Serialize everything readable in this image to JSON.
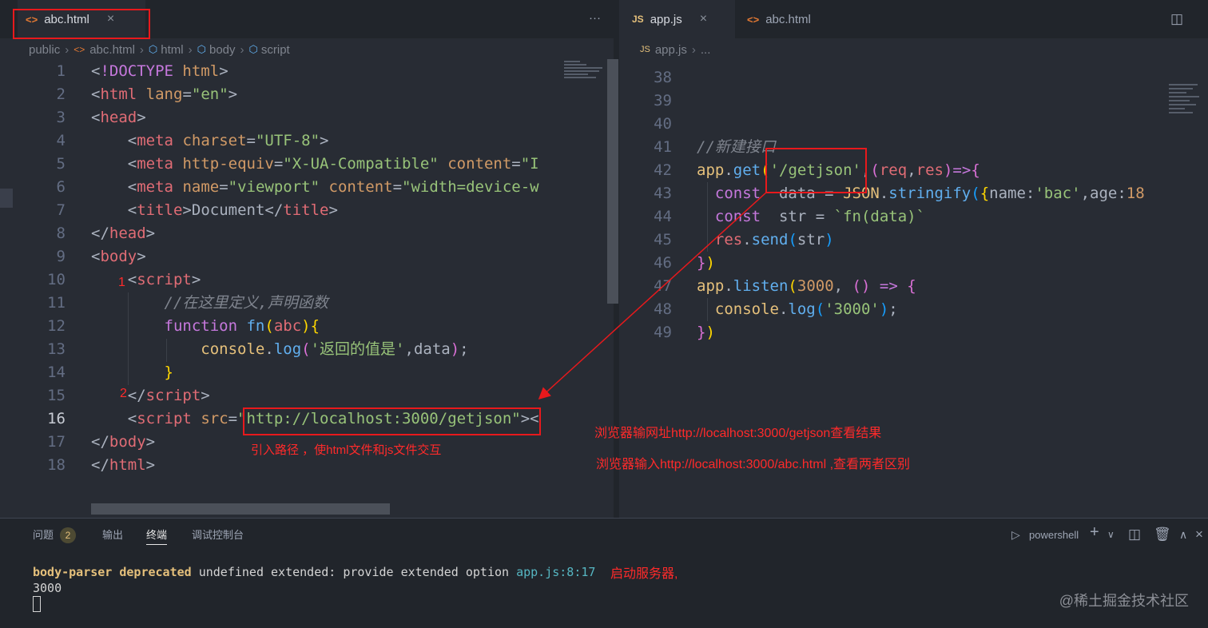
{
  "left_editor": {
    "tab": {
      "icon": "html-file-icon",
      "label": "abc.html",
      "close": "×"
    },
    "more": "···",
    "breadcrumb": [
      "public",
      "abc.html",
      "html",
      "body",
      "script"
    ],
    "lines": [
      {
        "n": "1",
        "tokens": [
          [
            "t-punc",
            "<"
          ],
          [
            "t-doc",
            "!DOCTYPE"
          ],
          [
            "t-txt",
            " "
          ],
          [
            "t-attr",
            "html"
          ],
          [
            "t-punc",
            ">"
          ]
        ]
      },
      {
        "n": "2",
        "tokens": [
          [
            "t-punc",
            "<"
          ],
          [
            "t-tag",
            "html"
          ],
          [
            "t-txt",
            " "
          ],
          [
            "t-attr",
            "lang"
          ],
          [
            "t-punc",
            "="
          ],
          [
            "t-str",
            "\"en\""
          ],
          [
            "t-punc",
            ">"
          ]
        ]
      },
      {
        "n": "3",
        "tokens": [
          [
            "t-punc",
            "<"
          ],
          [
            "t-tag",
            "head"
          ],
          [
            "t-punc",
            ">"
          ]
        ]
      },
      {
        "n": "4",
        "tokens": [
          [
            "t-txt",
            "    "
          ],
          [
            "t-punc",
            "<"
          ],
          [
            "t-tag",
            "meta"
          ],
          [
            "t-txt",
            " "
          ],
          [
            "t-attr",
            "charset"
          ],
          [
            "t-punc",
            "="
          ],
          [
            "t-str",
            "\"UTF-8\""
          ],
          [
            "t-punc",
            ">"
          ]
        ]
      },
      {
        "n": "5",
        "tokens": [
          [
            "t-txt",
            "    "
          ],
          [
            "t-punc",
            "<"
          ],
          [
            "t-tag",
            "meta"
          ],
          [
            "t-txt",
            " "
          ],
          [
            "t-attr",
            "http-equiv"
          ],
          [
            "t-punc",
            "="
          ],
          [
            "t-str",
            "\"X-UA-Compatible\""
          ],
          [
            "t-txt",
            " "
          ],
          [
            "t-attr",
            "content"
          ],
          [
            "t-punc",
            "="
          ],
          [
            "t-str",
            "\"I"
          ]
        ]
      },
      {
        "n": "6",
        "tokens": [
          [
            "t-txt",
            "    "
          ],
          [
            "t-punc",
            "<"
          ],
          [
            "t-tag",
            "meta"
          ],
          [
            "t-txt",
            " "
          ],
          [
            "t-attr",
            "name"
          ],
          [
            "t-punc",
            "="
          ],
          [
            "t-str",
            "\"viewport\""
          ],
          [
            "t-txt",
            " "
          ],
          [
            "t-attr",
            "content"
          ],
          [
            "t-punc",
            "="
          ],
          [
            "t-str",
            "\"width=device-w"
          ]
        ]
      },
      {
        "n": "7",
        "tokens": [
          [
            "t-txt",
            "    "
          ],
          [
            "t-punc",
            "<"
          ],
          [
            "t-tag",
            "title"
          ],
          [
            "t-punc",
            ">"
          ],
          [
            "t-txt",
            "Document"
          ],
          [
            "t-punc",
            "</"
          ],
          [
            "t-tag",
            "title"
          ],
          [
            "t-punc",
            ">"
          ]
        ]
      },
      {
        "n": "8",
        "tokens": [
          [
            "t-punc",
            "</"
          ],
          [
            "t-tag",
            "head"
          ],
          [
            "t-punc",
            ">"
          ]
        ]
      },
      {
        "n": "9",
        "tokens": [
          [
            "t-punc",
            "<"
          ],
          [
            "t-tag",
            "body"
          ],
          [
            "t-punc",
            ">"
          ]
        ]
      },
      {
        "n": "10",
        "tokens": [
          [
            "t-txt",
            "    "
          ],
          [
            "t-punc",
            "<"
          ],
          [
            "t-tag",
            "script"
          ],
          [
            "t-punc",
            ">"
          ]
        ]
      },
      {
        "n": "11",
        "tokens": [
          [
            "t-txt",
            "        "
          ],
          [
            "t-com",
            "//在这里定义,声明函数"
          ]
        ]
      },
      {
        "n": "12",
        "tokens": [
          [
            "t-txt",
            "        "
          ],
          [
            "t-kw",
            "function"
          ],
          [
            "t-txt",
            " "
          ],
          [
            "t-fn",
            "fn"
          ],
          [
            "t-brk2",
            "("
          ],
          [
            "t-var",
            "abc"
          ],
          [
            "t-brk2",
            ")"
          ],
          [
            "t-brk2",
            "{"
          ]
        ]
      },
      {
        "n": "13",
        "tokens": [
          [
            "t-txt",
            "            "
          ],
          [
            "t-cls",
            "console"
          ],
          [
            "t-punc",
            "."
          ],
          [
            "t-fn",
            "log"
          ],
          [
            "t-brk1",
            "("
          ],
          [
            "t-str",
            "'返回的值是'"
          ],
          [
            "t-punc",
            ","
          ],
          [
            "t-txt",
            "data"
          ],
          [
            "t-brk1",
            ")"
          ],
          [
            "t-punc",
            ";"
          ]
        ]
      },
      {
        "n": "14",
        "tokens": [
          [
            "t-txt",
            "        "
          ],
          [
            "t-brk2",
            "}"
          ]
        ]
      },
      {
        "n": "15",
        "tokens": [
          [
            "t-txt",
            "    "
          ],
          [
            "t-punc",
            "</"
          ],
          [
            "t-tag",
            "script"
          ],
          [
            "t-punc",
            ">"
          ]
        ]
      },
      {
        "n": "16",
        "tokens": [
          [
            "t-txt",
            "    "
          ],
          [
            "t-punc",
            "<"
          ],
          [
            "t-tag",
            "script"
          ],
          [
            "t-txt",
            " "
          ],
          [
            "t-attr",
            "src"
          ],
          [
            "t-punc",
            "="
          ],
          [
            "t-str",
            "\"http://localhost:3000/getjson\""
          ],
          [
            "t-punc",
            "><"
          ]
        ]
      },
      {
        "n": "17",
        "tokens": [
          [
            "t-punc",
            "</"
          ],
          [
            "t-tag",
            "body"
          ],
          [
            "t-punc",
            ">"
          ]
        ]
      },
      {
        "n": "18",
        "tokens": [
          [
            "t-punc",
            "</"
          ],
          [
            "t-tag",
            "html"
          ],
          [
            "t-punc",
            ">"
          ]
        ]
      }
    ],
    "annotations": {
      "marker_1": "1",
      "marker_2": "2",
      "import_note": "引入路径 ，使html文件和js文件交互"
    }
  },
  "right_editor": {
    "tabs": [
      {
        "icon": "js-file-icon",
        "icon_text": "JS",
        "label": "app.js",
        "close": "×",
        "active": true
      },
      {
        "icon": "html-file-icon",
        "icon_text": "<>",
        "label": "abc.html",
        "active": false
      }
    ],
    "breadcrumb": [
      "app.js",
      "..."
    ],
    "lines": [
      {
        "n": "38",
        "tokens": []
      },
      {
        "n": "39",
        "tokens": []
      },
      {
        "n": "40",
        "tokens": []
      },
      {
        "n": "41",
        "tokens": [
          [
            "t-com",
            "//新建接口"
          ]
        ]
      },
      {
        "n": "42",
        "tokens": [
          [
            "t-cls",
            "app"
          ],
          [
            "t-punc",
            "."
          ],
          [
            "t-fn",
            "get"
          ],
          [
            "t-brk2",
            "("
          ],
          [
            "t-str",
            "'/getjson'"
          ],
          [
            "t-punc",
            ","
          ],
          [
            "t-brk1",
            "("
          ],
          [
            "t-var",
            "req"
          ],
          [
            "t-punc",
            ","
          ],
          [
            "t-var",
            "res"
          ],
          [
            "t-brk1",
            ")"
          ],
          [
            "t-kw",
            "=>"
          ],
          [
            "t-brk1",
            "{"
          ]
        ]
      },
      {
        "n": "43",
        "tokens": [
          [
            "t-txt",
            "  "
          ],
          [
            "t-kw",
            "const"
          ],
          [
            "t-txt",
            "  "
          ],
          [
            "t-txt",
            "data = "
          ],
          [
            "t-cls",
            "JSON"
          ],
          [
            "t-punc",
            "."
          ],
          [
            "t-fn",
            "stringify"
          ],
          [
            "t-brk3",
            "("
          ],
          [
            "t-brk2",
            "{"
          ],
          [
            "t-prop",
            "name"
          ],
          [
            "t-punc",
            ":"
          ],
          [
            "t-str",
            "'bac'"
          ],
          [
            "t-punc",
            ","
          ],
          [
            "t-prop",
            "age"
          ],
          [
            "t-punc",
            ":"
          ],
          [
            "t-num",
            "18"
          ]
        ]
      },
      {
        "n": "44",
        "tokens": [
          [
            "t-txt",
            "  "
          ],
          [
            "t-kw",
            "const"
          ],
          [
            "t-txt",
            "  "
          ],
          [
            "t-txt",
            "str = "
          ],
          [
            "t-str",
            "`fn(data)`"
          ]
        ]
      },
      {
        "n": "45",
        "tokens": [
          [
            "t-txt",
            "  "
          ],
          [
            "t-var",
            "res"
          ],
          [
            "t-punc",
            "."
          ],
          [
            "t-fn",
            "send"
          ],
          [
            "t-brk3",
            "("
          ],
          [
            "t-txt",
            "str"
          ],
          [
            "t-brk3",
            ")"
          ]
        ]
      },
      {
        "n": "46",
        "tokens": [
          [
            "t-brk1",
            "}"
          ],
          [
            "t-brk2",
            ")"
          ]
        ]
      },
      {
        "n": "47",
        "tokens": [
          [
            "t-cls",
            "app"
          ],
          [
            "t-punc",
            "."
          ],
          [
            "t-fn",
            "listen"
          ],
          [
            "t-brk2",
            "("
          ],
          [
            "t-num",
            "3000"
          ],
          [
            "t-punc",
            ", "
          ],
          [
            "t-brk1",
            "()"
          ],
          [
            "t-txt",
            " "
          ],
          [
            "t-kw",
            "=>"
          ],
          [
            "t-txt",
            " "
          ],
          [
            "t-brk1",
            "{"
          ]
        ]
      },
      {
        "n": "48",
        "tokens": [
          [
            "t-txt",
            "  "
          ],
          [
            "t-cls",
            "console"
          ],
          [
            "t-punc",
            "."
          ],
          [
            "t-fn",
            "log"
          ],
          [
            "t-brk3",
            "("
          ],
          [
            "t-str",
            "'3000'"
          ],
          [
            "t-brk3",
            ")"
          ],
          [
            "t-punc",
            ";"
          ]
        ]
      },
      {
        "n": "49",
        "tokens": [
          [
            "t-brk1",
            "}"
          ],
          [
            "t-brk2",
            ")"
          ]
        ]
      }
    ],
    "annotations": {
      "browser_note_1": "浏览器输网址http://localhost:3000/getjson查看结果",
      "browser_note_2": "浏览器输入http://localhost:3000/abc.html ,查看两者区别"
    }
  },
  "panel": {
    "tabs": [
      {
        "label": "问题",
        "badge": "2"
      },
      {
        "label": "输出"
      },
      {
        "label": "终端",
        "active": true
      },
      {
        "label": "调试控制台"
      }
    ],
    "shell_label": "powershell",
    "terminal": {
      "warn_bold": "body-parser deprecated",
      "warn_rest": " undefined extended: provide extended option ",
      "warn_loc": "app.js:8:17",
      "output": "3000"
    },
    "annotation": "启动服务器,",
    "watermark": "@稀土掘金技术社区"
  }
}
